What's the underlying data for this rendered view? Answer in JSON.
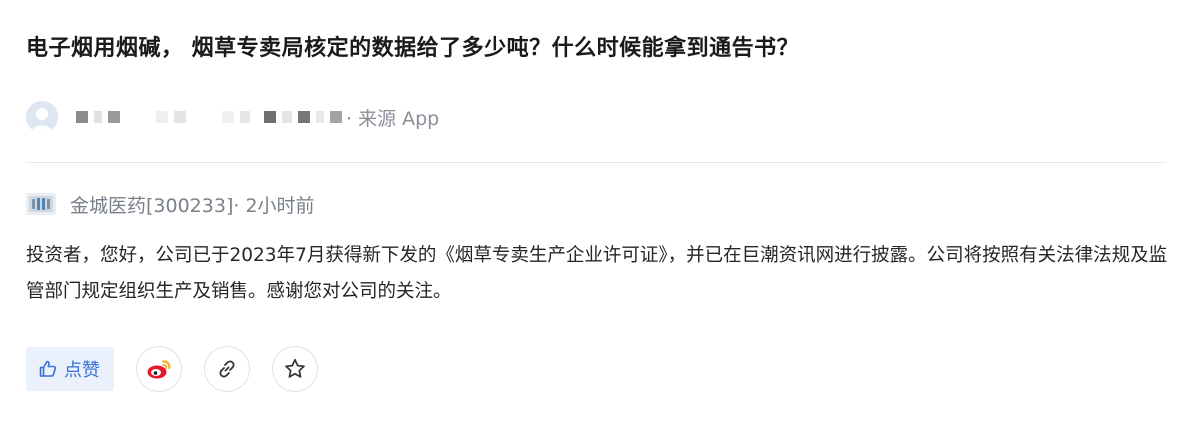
{
  "question": {
    "title": "电子烟用烟碱， 烟草专卖局核定的数据给了多少吨？什么时候能拿到通告书？",
    "source_text": "· 来源 App"
  },
  "reply": {
    "company": "金城医药[300233]",
    "time": " · 2小时前",
    "content": "投资者，您好，公司已于2023年7月获得新下发的《烟草专卖生产企业许可证》，并已在巨潮资讯网进行披露。公司将按照有关法律法规及监管部门规定组织生产及销售。感谢您对公司的关注。"
  },
  "actions": {
    "like_label": "点赞",
    "accent_color": "#3a6fd8",
    "icons": [
      "thumb-up-icon",
      "weibo-icon",
      "link-icon",
      "star-icon"
    ]
  }
}
